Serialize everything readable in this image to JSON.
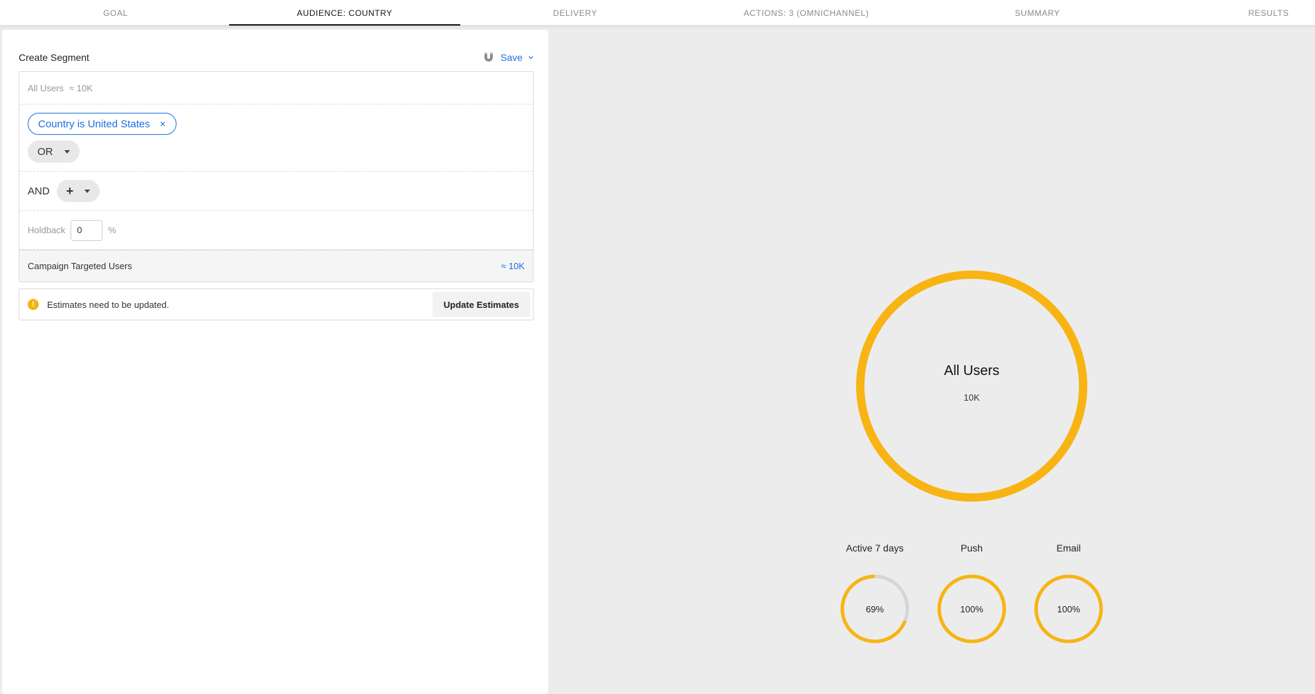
{
  "tabs": [
    {
      "label": "GOAL"
    },
    {
      "label": "AUDIENCE: COUNTRY"
    },
    {
      "label": "DELIVERY"
    },
    {
      "label": "ACTIONS: 3 (OMNICHANNEL)"
    },
    {
      "label": "SUMMARY"
    },
    {
      "label": "RESULTS"
    }
  ],
  "panel": {
    "title": "Create Segment",
    "save_label": "Save",
    "all_users_label": "All Users",
    "all_users_count": "≈ 10K",
    "filter_chip": "Country is United States",
    "filter_chip_remove": "×",
    "or_label": "OR",
    "and_label": "AND",
    "add_label": "+",
    "holdback_label": "Holdback",
    "holdback_value": "0",
    "holdback_unit": "%",
    "targeted_label": "Campaign Targeted Users",
    "targeted_value": "≈ 10K",
    "estimate_icon": "!",
    "estimate_text": "Estimates need to be updated.",
    "update_label": "Update Estimates"
  },
  "overview": {
    "title": "All Users",
    "count": "10K",
    "stats": [
      {
        "label": "Active 7 days",
        "value": "69%",
        "fraction": 0.69
      },
      {
        "label": "Push",
        "value": "100%",
        "fraction": 1.0
      },
      {
        "label": "Email",
        "value": "100%",
        "fraction": 1.0
      }
    ]
  },
  "colors": {
    "accent": "#1b6fe0",
    "ring": "#f7b413",
    "ring_track": "#d6d6d6",
    "warning": "#f5b312"
  }
}
